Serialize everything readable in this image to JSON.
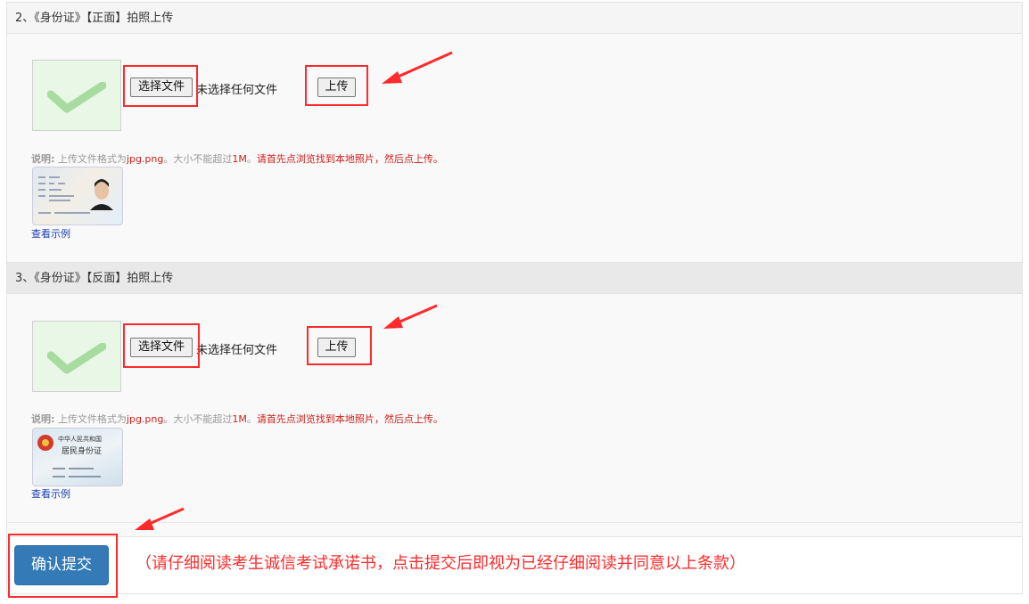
{
  "sections": [
    {
      "title": "2、《身份证》【正面】拍照上传",
      "choose_label": "选择文件",
      "no_file_text": "未选择任何文件",
      "upload_label": "上传",
      "note_label": "说明:",
      "note_text_1": "上传文件格式为",
      "note_formats": "jpg.png",
      "note_text_2": "。大小不能超过",
      "note_size": "1M",
      "note_text_3": "。",
      "note_warning": "请首先点浏览找到本地照片，然后点上传。",
      "example_link": "查看示例"
    },
    {
      "title": "3、《身份证》【反面】拍照上传",
      "choose_label": "选择文件",
      "no_file_text": "未选择任何文件",
      "upload_label": "上传",
      "note_label": "说明:",
      "note_text_1": "上传文件格式为",
      "note_formats": "jpg.png",
      "note_text_2": "。大小不能超过",
      "note_size": "1M",
      "note_text_3": "。",
      "note_warning": "请首先点浏览找到本地照片，然后点上传。",
      "example_link": "查看示例",
      "sample_text_1": "中华人民共和国",
      "sample_text_2": "居民身份证"
    }
  ],
  "footer": {
    "submit_label": "确认提交",
    "notice": "（请仔细阅读考生诚信考试承诺书，点击提交后即视为已经仔细阅读并同意以上条款）"
  },
  "colors": {
    "accent_red": "#ff2a2a",
    "submit_blue": "#337ab7",
    "link_blue": "#1a3fb0",
    "check_green": "#a8dba0"
  },
  "icons": [
    "checkmark-icon",
    "arrow-icon",
    "id-photo-icon",
    "national-emblem-icon"
  ]
}
